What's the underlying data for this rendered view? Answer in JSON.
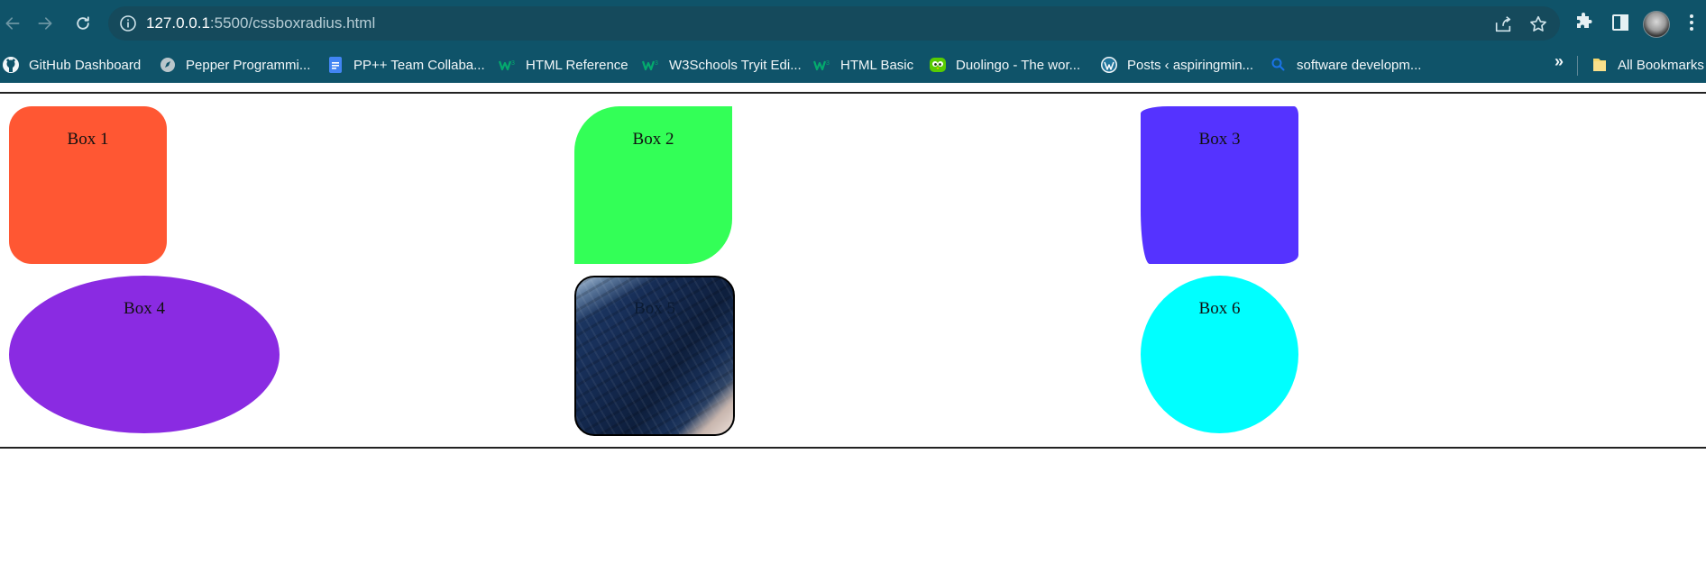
{
  "browser": {
    "url_host": "127.0.0.1",
    "url_rest": ":5500/cssboxradius.html",
    "icons": {
      "back": "arrow-left-icon",
      "forward": "arrow-right-icon",
      "reload": "reload-icon",
      "site_info": "info-icon",
      "share": "share-icon",
      "bookmark_star": "star-icon",
      "extensions": "puzzle-icon",
      "side_panel": "side-panel-icon",
      "menu": "kebab-menu-icon"
    }
  },
  "bookmarks": {
    "items": [
      {
        "label": "GitHub Dashboard",
        "icon": "github-icon"
      },
      {
        "label": "Pepper Programmi...",
        "icon": "compass-icon"
      },
      {
        "label": "PP++ Team Collaba...",
        "icon": "docs-icon"
      },
      {
        "label": "HTML Reference",
        "icon": "w3schools-icon"
      },
      {
        "label": "W3Schools Tryit Edi...",
        "icon": "w3schools-icon"
      },
      {
        "label": "HTML Basic",
        "icon": "w3schools-icon"
      },
      {
        "label": "Duolingo - The wor...",
        "icon": "duolingo-icon"
      },
      {
        "label": "Posts ‹ aspiringmin...",
        "icon": "wordpress-icon"
      },
      {
        "label": "software developm...",
        "icon": "search-icon"
      }
    ],
    "overflow": "»",
    "all_bookmarks": "All Bookmarks"
  },
  "boxes": [
    {
      "label": "Box 1",
      "color": "#ff5733"
    },
    {
      "label": "Box 2",
      "color": "#33ff57"
    },
    {
      "label": "Box 3",
      "color": "#5533ff"
    },
    {
      "label": "Box 4",
      "color": "#8a2be2"
    },
    {
      "label": "Box 5",
      "background": "mountain-photo"
    },
    {
      "label": "Box 6",
      "color": "#00ffff"
    }
  ]
}
